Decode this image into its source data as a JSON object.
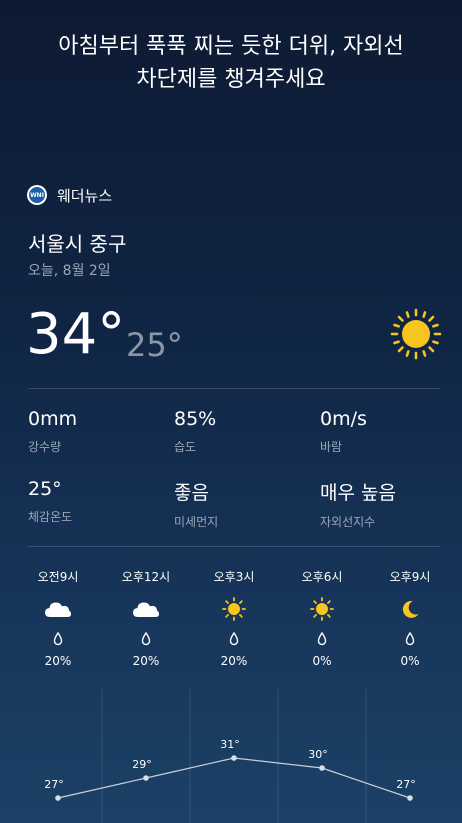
{
  "headline": {
    "line1": "아침부터 푹푹 찌는 듯한 더위, 자외선",
    "line2": "차단제를 챙겨주세요"
  },
  "brand": {
    "name": "웨더뉴스",
    "logo_text": "WNI",
    "logo_color": "#1d5ea8"
  },
  "location": "서울시 중구",
  "date": "오늘, 8월 2일",
  "current": {
    "high": "34°",
    "low": "25°",
    "condition_icon": "sun-icon"
  },
  "stats": [
    {
      "value": "0mm",
      "label": "강수량"
    },
    {
      "value": "85%",
      "label": "습도"
    },
    {
      "value": "0m/s",
      "label": "바람"
    },
    {
      "value": "25°",
      "label": "체감온도"
    },
    {
      "value": "좋음",
      "label": "미세먼지"
    },
    {
      "value": "매우 높음",
      "label": "자외선지수"
    }
  ],
  "hourly": [
    {
      "time": "오전9시",
      "icon": "cloud-icon",
      "pop": "20%",
      "temp": "27°",
      "temp_value": 27
    },
    {
      "time": "오후12시",
      "icon": "cloud-icon",
      "pop": "20%",
      "temp": "29°",
      "temp_value": 29
    },
    {
      "time": "오후3시",
      "icon": "sun-icon",
      "pop": "20%",
      "temp": "31°",
      "temp_value": 31
    },
    {
      "time": "오후6시",
      "icon": "sun-icon",
      "pop": "0%",
      "temp": "30°",
      "temp_value": 30
    },
    {
      "time": "오후9시",
      "icon": "moon-icon",
      "pop": "0%",
      "temp": "27°",
      "temp_value": 27
    }
  ],
  "colors": {
    "sun": "#f7c51e",
    "moon": "#f7c51e",
    "cloud": "#ffffff",
    "secondary_text": "#9aa6b8"
  }
}
